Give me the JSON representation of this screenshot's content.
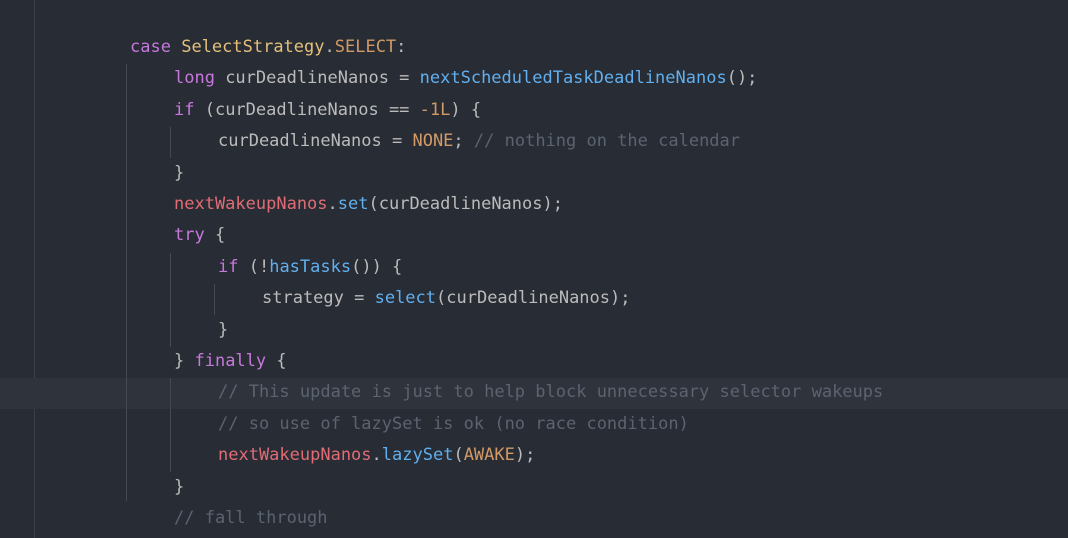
{
  "editor": {
    "language": "java",
    "theme_colors": {
      "background": "#282c34",
      "keyword": "#c678dd",
      "type": "#e5c07b",
      "constant": "#d19a66",
      "function": "#61afef",
      "field": "#e06c75",
      "comment": "#5c6370",
      "text": "#bbbbbb"
    },
    "lines": [
      [
        {
          "t": "case",
          "c": "kw"
        },
        {
          "t": " ",
          "c": "punc"
        },
        {
          "t": "SelectStrategy",
          "c": "type"
        },
        {
          "t": ".",
          "c": "punc"
        },
        {
          "t": "SELECT",
          "c": "const"
        },
        {
          "t": ":",
          "c": "punc"
        }
      ],
      [
        {
          "t": "long",
          "c": "kw"
        },
        {
          "t": " curDeadlineNanos = ",
          "c": "punc"
        },
        {
          "t": "nextScheduledTaskDeadlineNanos",
          "c": "fn"
        },
        {
          "t": "();",
          "c": "punc"
        }
      ],
      [
        {
          "t": "if",
          "c": "kw"
        },
        {
          "t": " (curDeadlineNanos == ",
          "c": "punc"
        },
        {
          "t": "-1L",
          "c": "num"
        },
        {
          "t": ") {",
          "c": "punc"
        }
      ],
      [
        {
          "t": "curDeadlineNanos = ",
          "c": "punc"
        },
        {
          "t": "NONE",
          "c": "const"
        },
        {
          "t": "; ",
          "c": "punc"
        },
        {
          "t": "// nothing on the calendar",
          "c": "cmt"
        }
      ],
      [
        {
          "t": "}",
          "c": "punc"
        }
      ],
      [
        {
          "t": "nextWakeupNanos",
          "c": "field"
        },
        {
          "t": ".",
          "c": "punc"
        },
        {
          "t": "set",
          "c": "fn"
        },
        {
          "t": "(curDeadlineNanos);",
          "c": "punc"
        }
      ],
      [
        {
          "t": "try",
          "c": "kw"
        },
        {
          "t": " {",
          "c": "punc"
        }
      ],
      [
        {
          "t": "if",
          "c": "kw"
        },
        {
          "t": " (!",
          "c": "punc"
        },
        {
          "t": "hasTasks",
          "c": "fn"
        },
        {
          "t": "()) {",
          "c": "punc"
        }
      ],
      [
        {
          "t": "strategy = ",
          "c": "punc"
        },
        {
          "t": "select",
          "c": "fn"
        },
        {
          "t": "(curDeadlineNanos);",
          "c": "punc"
        }
      ],
      [
        {
          "t": "}",
          "c": "punc"
        }
      ],
      [
        {
          "t": "} ",
          "c": "punc"
        },
        {
          "t": "finally",
          "c": "kw"
        },
        {
          "t": " {",
          "c": "punc"
        }
      ],
      [
        {
          "t": "// This update is just to help block unnecessary selector wakeups",
          "c": "cmt"
        }
      ],
      [
        {
          "t": "// so use of lazySet is ok (no race condition)",
          "c": "cmt"
        }
      ],
      [
        {
          "t": "nextWakeupNanos",
          "c": "field"
        },
        {
          "t": ".",
          "c": "punc"
        },
        {
          "t": "lazySet",
          "c": "fn"
        },
        {
          "t": "(",
          "c": "punc"
        },
        {
          "t": "AWAKE",
          "c": "const"
        },
        {
          "t": ");",
          "c": "punc"
        }
      ],
      [
        {
          "t": "}",
          "c": "punc"
        }
      ],
      [
        {
          "t": "// fall through",
          "c": "cmt"
        }
      ]
    ]
  }
}
